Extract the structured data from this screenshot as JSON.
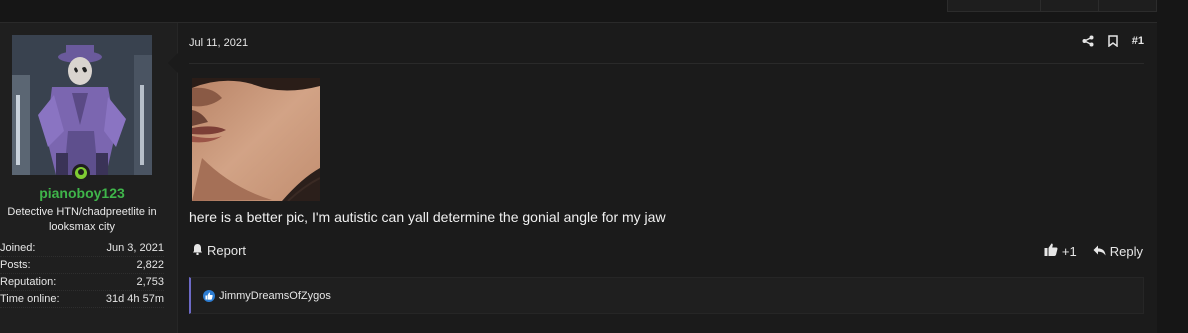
{
  "user": {
    "username": "pianoboy123",
    "title": "Detective HTN/chadpreetlite in looksmax city",
    "stats": [
      {
        "label": "Joined:",
        "value": "Jun 3, 2021"
      },
      {
        "label": "Posts:",
        "value": "2,822"
      },
      {
        "label": "Reputation:",
        "value": "2,753"
      },
      {
        "label": "Time online:",
        "value": "31d 4h 57m"
      }
    ]
  },
  "post": {
    "date": "Jul 11, 2021",
    "number": "#1",
    "message": "here is a better pic, I'm autistic can yall determine the gonial angle for my jaw",
    "report_label": "Report",
    "like_count": "+1",
    "reply_label": "Reply",
    "reactions_user": "JimmyDreamsOfZygos"
  },
  "colors": {
    "username": "#3fb54a",
    "online": "#7fcc33",
    "reaction_accent": "#6d6ac6",
    "like_blue": "#2d7dd2"
  },
  "icons": {
    "share": "share-icon",
    "bookmark": "bookmark-icon",
    "bell": "bell-icon",
    "thumbs_up": "thumbs-up-icon",
    "reply": "reply-icon",
    "online": "online-status-icon"
  }
}
